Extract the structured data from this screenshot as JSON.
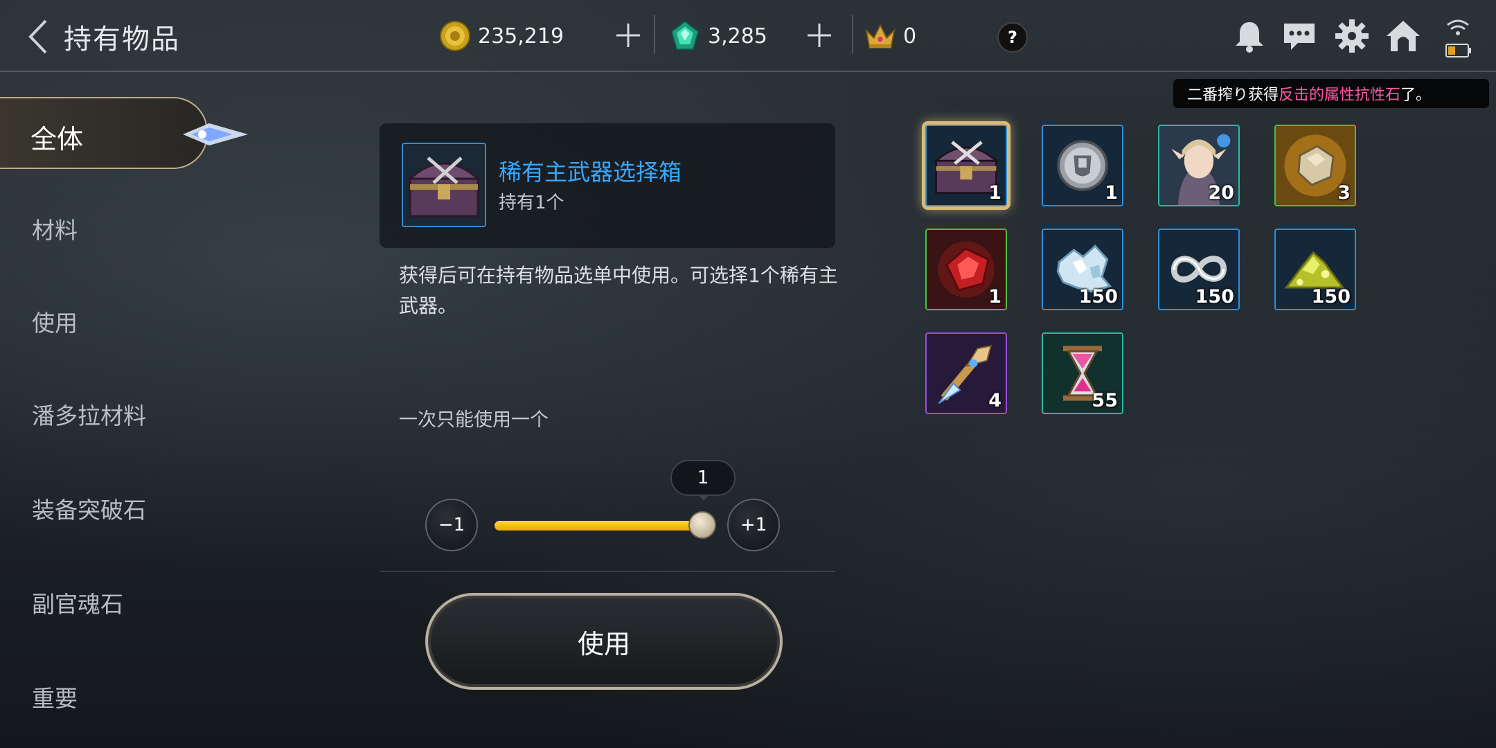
{
  "header": {
    "title": "持有物品",
    "gold": "235,219",
    "gems": "3,285",
    "crowns": "0",
    "help": "?"
  },
  "notice": {
    "prefix": "二番搾り获得",
    "highlight": "反击的属性抗性石",
    "suffix": "了。",
    "highlight_color": "#ff5aa8"
  },
  "sidebar": {
    "active": "全体",
    "items": [
      "材料",
      "使用",
      "潘多拉材料",
      "装备突破石",
      "副官魂石",
      "重要"
    ]
  },
  "detail": {
    "name": "稀有主武器选择箱",
    "owned": "持有1个",
    "description": "获得后可在持有物品选单中使用。可选择1个稀有主武器。",
    "limit": "一次只能使用一个",
    "quantity": "1",
    "minus_label": "−1",
    "plus_label": "+1",
    "slider_fraction": 1.0,
    "use_label": "使用"
  },
  "inventory": [
    {
      "icon": "treasure-chest-icon",
      "count": "1",
      "rarity": "blue",
      "selected": true
    },
    {
      "icon": "silver-coin-icon",
      "count": "1",
      "rarity": "blue"
    },
    {
      "icon": "elf-portrait-icon",
      "count": "20",
      "rarity": "teal"
    },
    {
      "icon": "ore-stone-icon",
      "count": "3",
      "rarity": "green"
    },
    {
      "icon": "red-crystal-icon",
      "count": "1",
      "rarity": "green"
    },
    {
      "icon": "ice-crystal-icon",
      "count": "150",
      "rarity": "blue"
    },
    {
      "icon": "infinity-loop-icon",
      "count": "150",
      "rarity": "blue"
    },
    {
      "icon": "gold-pile-icon",
      "count": "150",
      "rarity": "blue"
    },
    {
      "icon": "crystal-dagger-icon",
      "count": "4",
      "rarity": "purple"
    },
    {
      "icon": "hourglass-icon",
      "count": "55",
      "rarity": "teal"
    }
  ],
  "colors": {
    "accent_blue": "#39a7ff",
    "slider_yellow": "#ffd83a",
    "select_gold": "#d8bb7a"
  }
}
